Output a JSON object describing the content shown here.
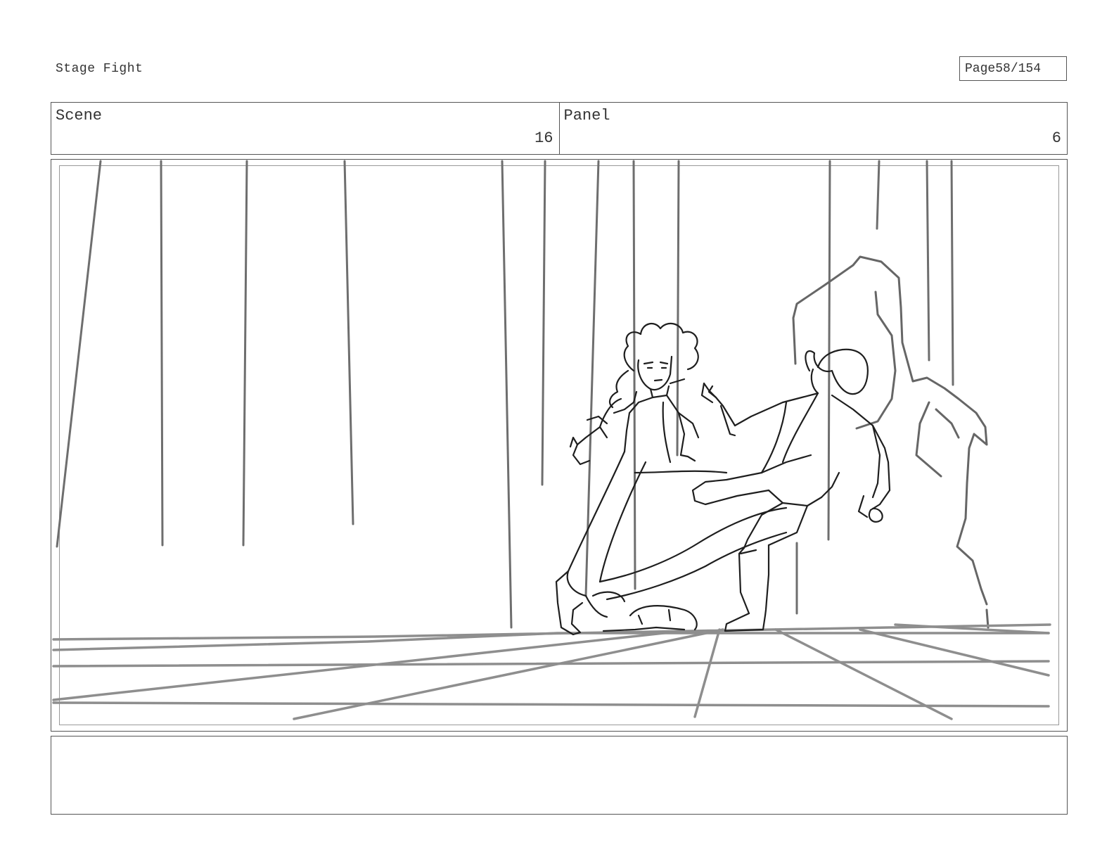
{
  "header": {
    "project_title": "Stage Fight",
    "page_label": "Page",
    "page_number": "58/154"
  },
  "info": {
    "scene_label": "Scene",
    "scene_value": "16",
    "panel_label": "Panel",
    "panel_value": "6"
  },
  "notes": {
    "text": ""
  }
}
